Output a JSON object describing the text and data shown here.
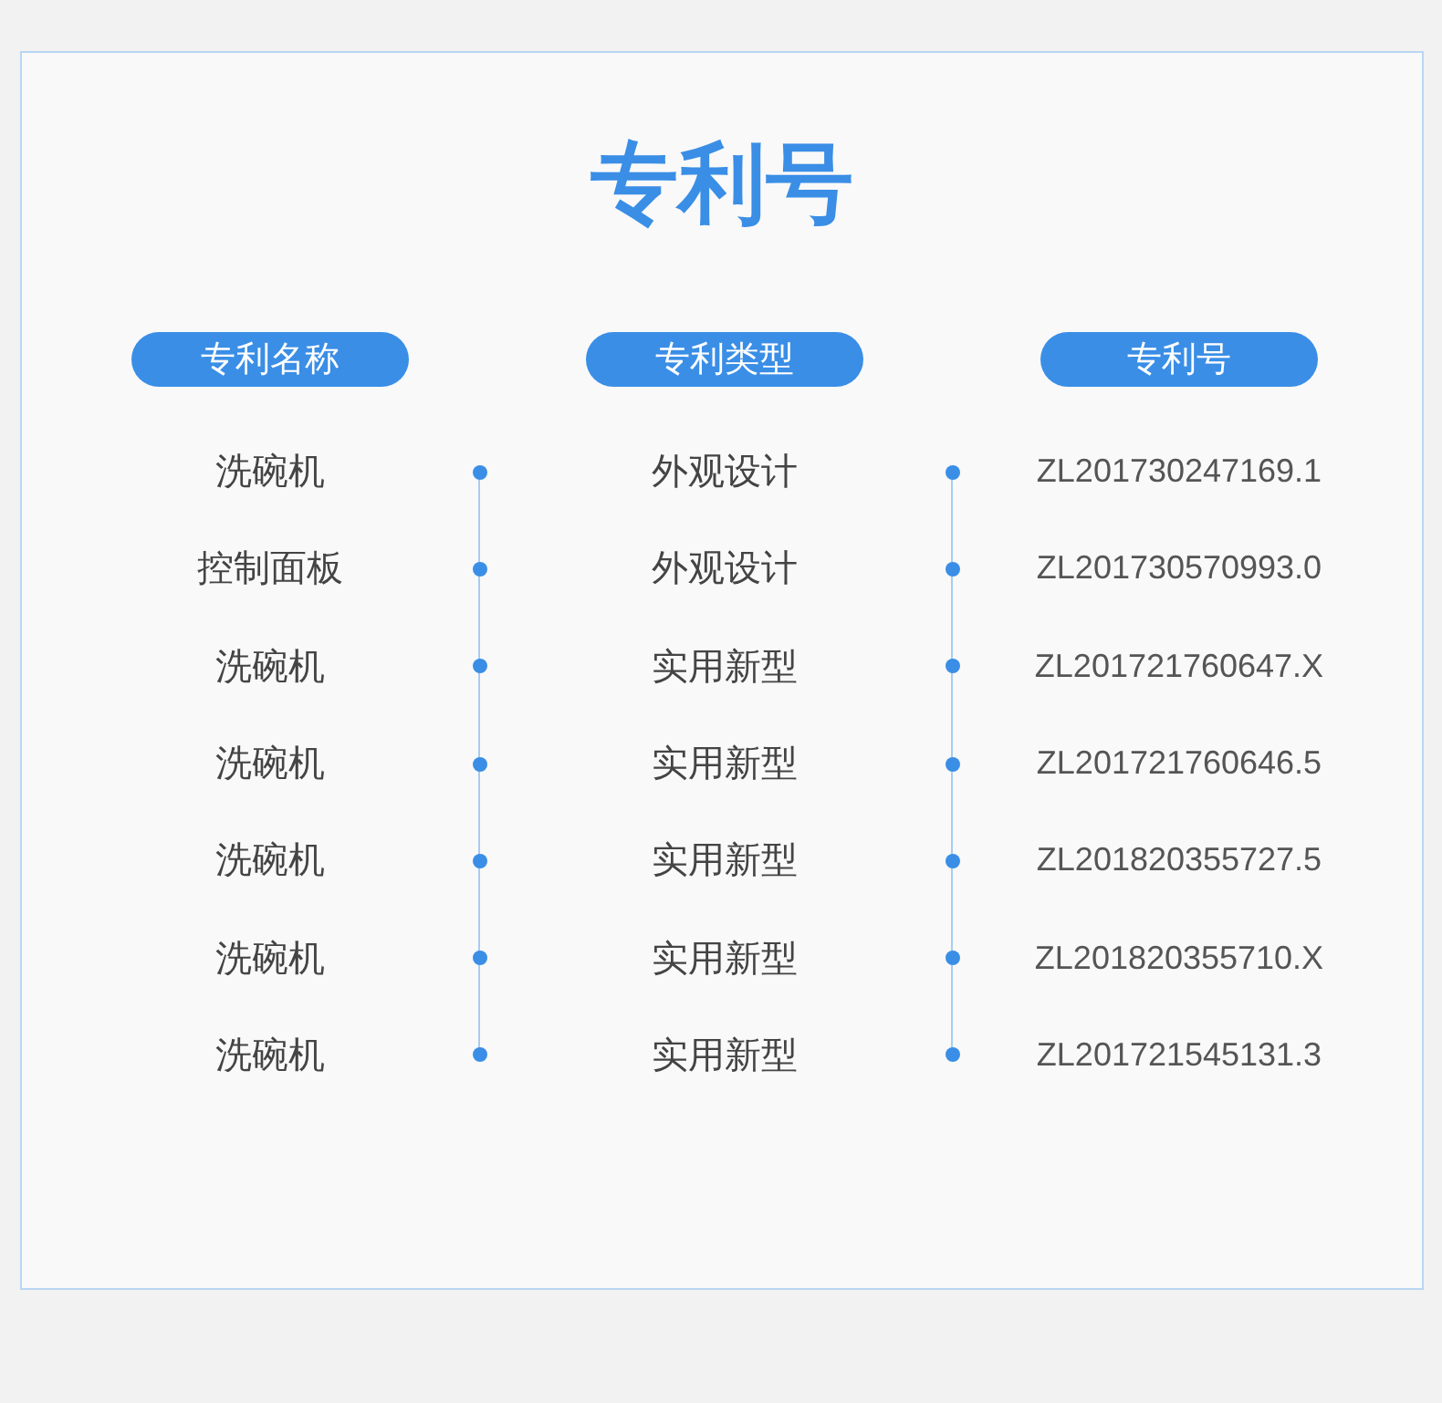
{
  "title": "专利号",
  "columns": [
    "专利名称",
    "专利类型",
    "专利号"
  ],
  "rows": [
    {
      "name": "洗碗机",
      "type": "外观设计",
      "number": "ZL201730247169.1"
    },
    {
      "name": "控制面板",
      "type": "外观设计",
      "number": "ZL201730570993.0"
    },
    {
      "name": "洗碗机",
      "type": "实用新型",
      "number": "ZL201721760647.X"
    },
    {
      "name": "洗碗机",
      "type": "实用新型",
      "number": "ZL201721760646.5"
    },
    {
      "name": "洗碗机",
      "type": "实用新型",
      "number": "ZL201820355727.5"
    },
    {
      "name": "洗碗机",
      "type": "实用新型",
      "number": "ZL201820355710.X"
    },
    {
      "name": "洗碗机",
      "type": "实用新型",
      "number": "ZL201721545131.3"
    }
  ]
}
